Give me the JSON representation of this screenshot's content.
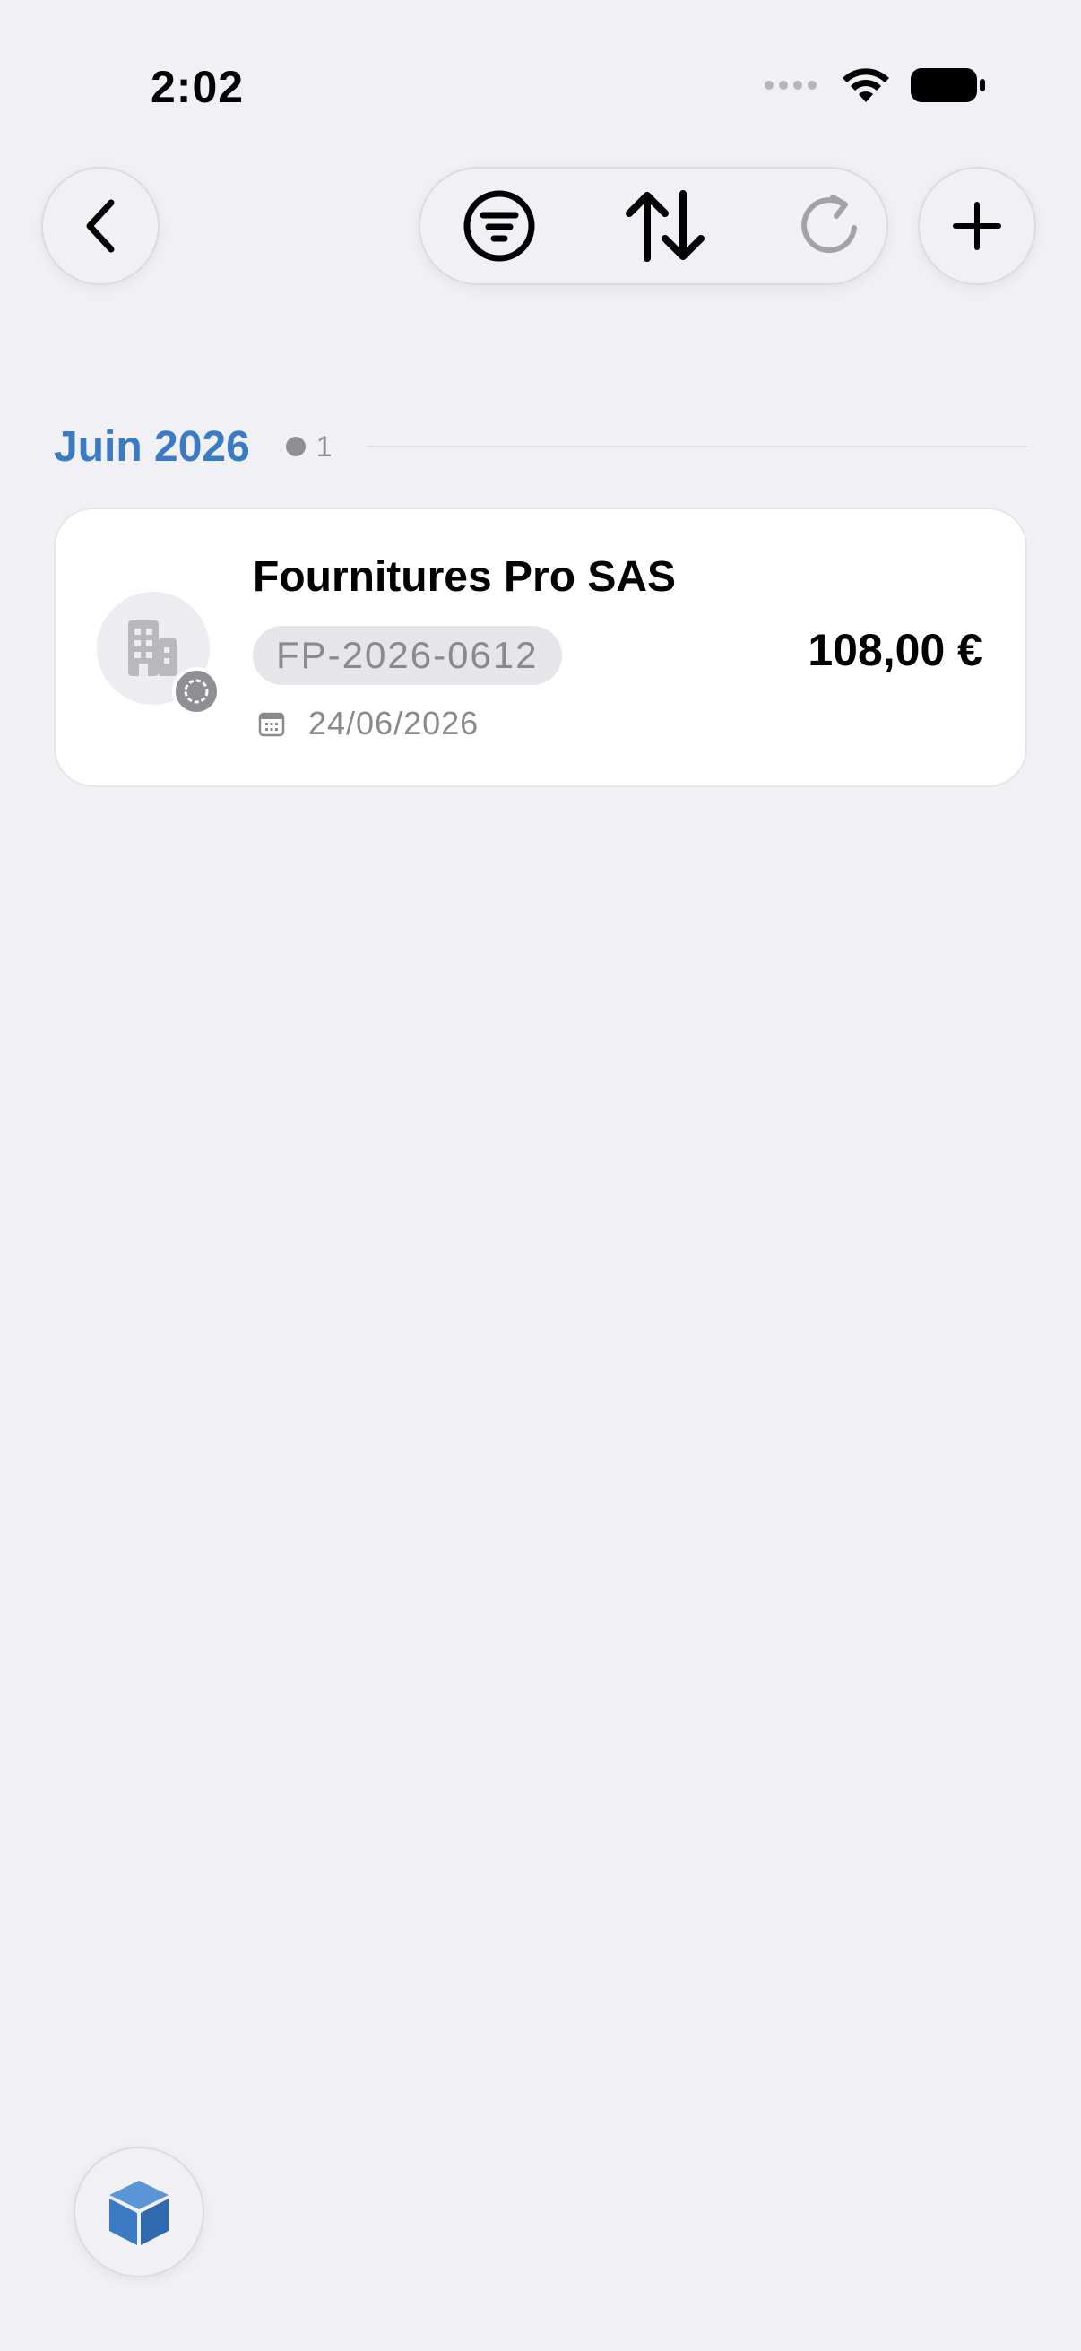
{
  "status_bar": {
    "time": "2:02"
  },
  "toolbar": {
    "back_icon": "chevron-left-icon",
    "filter_icon": "filter-icon",
    "sort_icon": "sort-icon",
    "refresh_icon": "refresh-icon",
    "add_icon": "plus-icon"
  },
  "section": {
    "title": "Juin 2026",
    "count": "1"
  },
  "invoice": {
    "vendor": "Fournitures Pro SAS",
    "reference": "FP-2026-0612",
    "date": "24/06/2026",
    "amount": "108,00 €"
  },
  "fab": {
    "icon": "box-icon",
    "color": "#3B7BC4"
  },
  "colors": {
    "accent": "#3B7BC4",
    "background": "#F1F0F5",
    "secondary_text": "#8A8A8E"
  }
}
